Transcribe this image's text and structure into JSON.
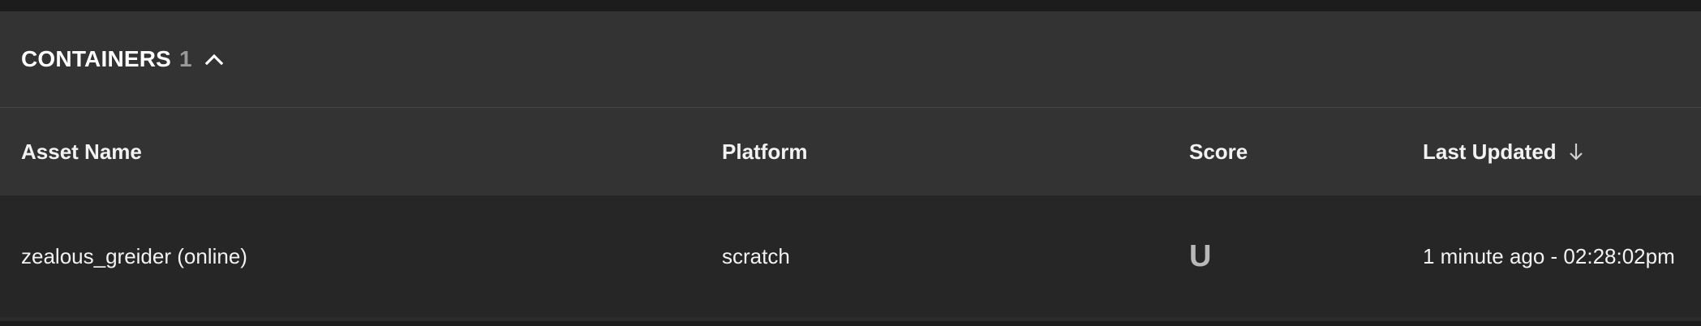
{
  "section": {
    "title": "CONTAINERS",
    "count": "1",
    "expand_icon": "chevron-up-icon"
  },
  "table": {
    "columns": [
      {
        "label": "Asset Name"
      },
      {
        "label": "Platform"
      },
      {
        "label": "Score"
      },
      {
        "label": "Last Updated",
        "sort_icon": "arrow-down-icon"
      }
    ],
    "rows": [
      {
        "asset_name": "zealous_greider (online)",
        "platform": "scratch",
        "score": "U",
        "last_updated": "1 minute ago - 02:28:02pm"
      }
    ]
  },
  "colors": {
    "background": "#1f1f1f",
    "header_bg": "#333333",
    "row_bg": "#262626",
    "count_text": "#9a9a9a",
    "score_text": "#b8b8b8"
  }
}
